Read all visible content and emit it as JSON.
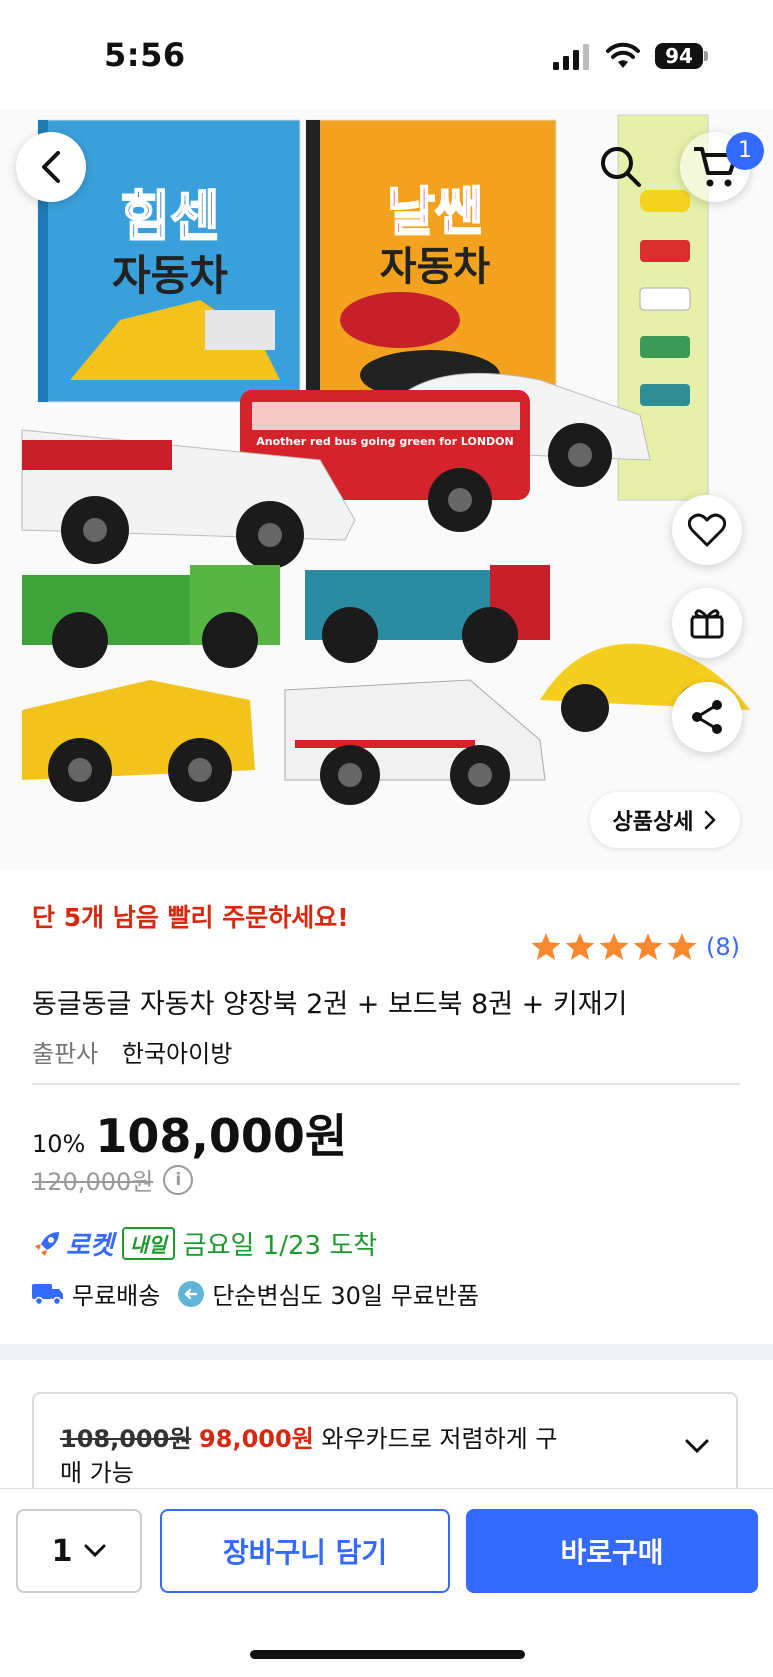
{
  "status_bar": {
    "time": "5:56",
    "battery": "94"
  },
  "header": {
    "cart_count": "1"
  },
  "hero": {
    "book1_title_line1": "힘센",
    "book1_title_line2": "자동차",
    "book2_title_line1": "날쌘",
    "book2_title_line2": "자동차",
    "bus_caption": "Another red bus going green for LONDON",
    "detail_button": "상품상세"
  },
  "product": {
    "stock_warning": "단 5개 남음 빨리 주문하세요!",
    "rating_stars": 5,
    "review_count": "(8)",
    "title": "동글동글 자동차 양장북 2권 + 보드북 8권 + 키재기",
    "publisher_label": "출판사",
    "publisher": "한국아이방",
    "discount": "10%",
    "price": "108,000원",
    "original_price": "120,000원",
    "rocket_label": "로켓",
    "rocket_badge": "내일",
    "arrival": "금요일 1/23 도착",
    "free_shipping": "무료배송",
    "free_return": "단순변심도 30일 무료반품"
  },
  "wow": {
    "strike_price": "108,000원",
    "wow_price": "98,000원",
    "text": "와우카드로 저렴하게 구매 가능"
  },
  "bottom": {
    "quantity": "1",
    "cart_button": "장바구니 담기",
    "buy_button": "바로구매"
  },
  "colors": {
    "accent": "#346aff",
    "warning": "#d62a10",
    "rocket_green": "#1d9a2e",
    "star": "#f7882f"
  }
}
